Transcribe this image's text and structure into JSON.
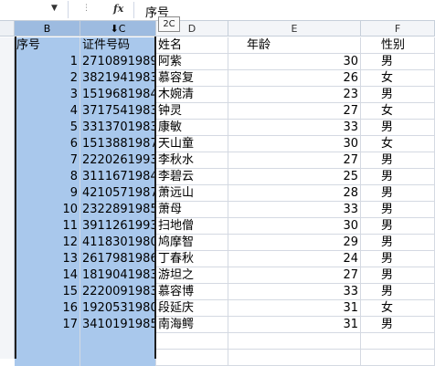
{
  "formula_bar": {
    "fx_label": "fx",
    "content": "序号",
    "tooltip": "2C"
  },
  "columns": [
    "B",
    "C",
    "D",
    "E",
    "F"
  ],
  "header": {
    "seq": "序号",
    "id": "证件号码",
    "name": "姓名",
    "age": "年龄",
    "gender": "性别"
  },
  "rows": [
    {
      "seq": "1",
      "id": "2710891989",
      "name": "阿紫",
      "age": "30",
      "gender": "男"
    },
    {
      "seq": "2",
      "id": "3821941983",
      "name": "慕容复",
      "age": "26",
      "gender": "女"
    },
    {
      "seq": "3",
      "id": "1519681984",
      "name": "木婉清",
      "age": "23",
      "gender": "男"
    },
    {
      "seq": "4",
      "id": "3717541983",
      "name": "钟灵",
      "age": "27",
      "gender": "女"
    },
    {
      "seq": "5",
      "id": "3313701983",
      "name": "康敏",
      "age": "33",
      "gender": "男"
    },
    {
      "seq": "6",
      "id": "1513881987",
      "name": "天山童",
      "age": "30",
      "gender": "女"
    },
    {
      "seq": "7",
      "id": "2220261993",
      "name": "李秋水",
      "age": "27",
      "gender": "男"
    },
    {
      "seq": "8",
      "id": "3111671984",
      "name": "李碧云",
      "age": "25",
      "gender": "男"
    },
    {
      "seq": "9",
      "id": "4210571987",
      "name": "萧远山",
      "age": "28",
      "gender": "男"
    },
    {
      "seq": "10",
      "id": "2322891985",
      "name": "萧母",
      "age": "33",
      "gender": "男"
    },
    {
      "seq": "11",
      "id": "3911261993",
      "name": "扫地僧",
      "age": "30",
      "gender": "男"
    },
    {
      "seq": "12",
      "id": "4118301980",
      "name": "鸠摩智",
      "age": "29",
      "gender": "男"
    },
    {
      "seq": "13",
      "id": "2617981986",
      "name": "丁春秋",
      "age": "24",
      "gender": "男"
    },
    {
      "seq": "14",
      "id": "1819041983",
      "name": "游坦之",
      "age": "27",
      "gender": "男"
    },
    {
      "seq": "15",
      "id": "2220091983",
      "name": "慕容博",
      "age": "33",
      "gender": "男"
    },
    {
      "seq": "16",
      "id": "1920531980",
      "name": "段延庆",
      "age": "31",
      "gender": "女"
    },
    {
      "seq": "17",
      "id": "3410191985",
      "name": "南海鳄",
      "age": "31",
      "gender": "男"
    }
  ]
}
